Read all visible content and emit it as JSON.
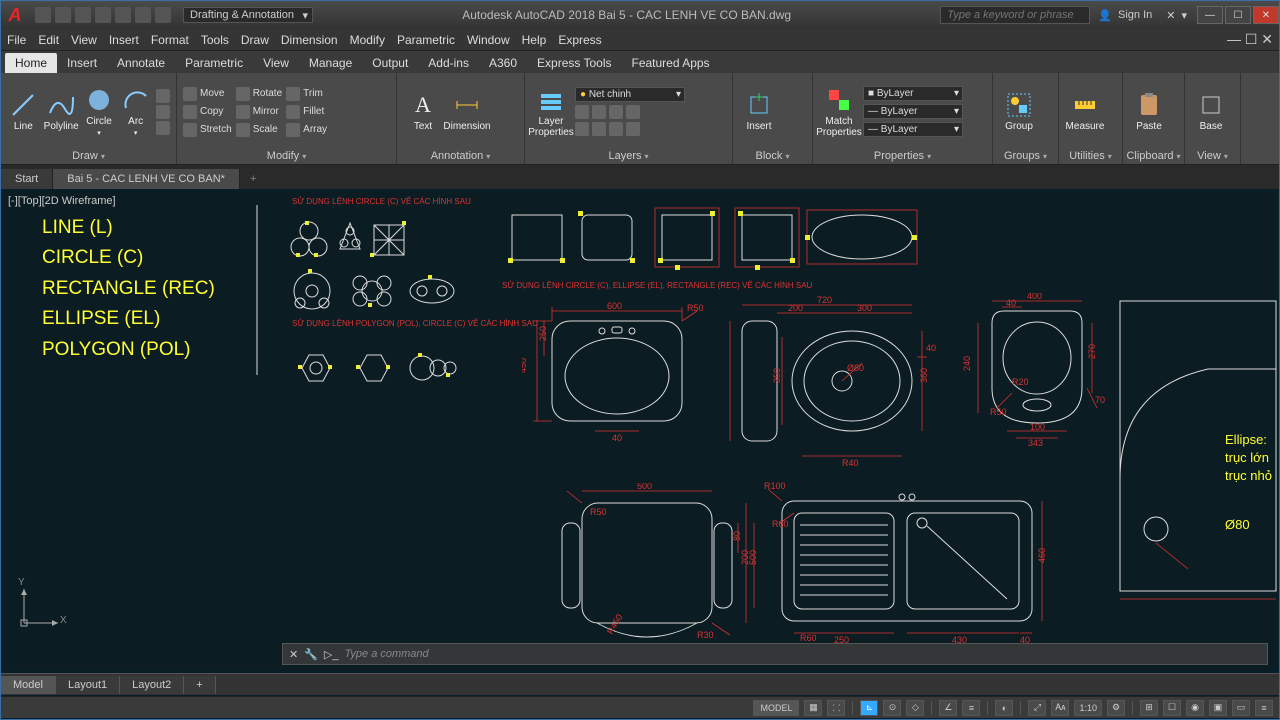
{
  "window": {
    "app_title": "Autodesk AutoCAD 2018   Bai 5 - CAC LENH VE CO BAN.dwg",
    "workspace": "Drafting & Annotation",
    "search_placeholder": "Type a keyword or phrase",
    "signin": "Sign In"
  },
  "menubar": [
    "File",
    "Edit",
    "View",
    "Insert",
    "Format",
    "Tools",
    "Draw",
    "Dimension",
    "Modify",
    "Parametric",
    "Window",
    "Help",
    "Express"
  ],
  "ribbon_tabs": [
    "Home",
    "Insert",
    "Annotate",
    "Parametric",
    "View",
    "Manage",
    "Output",
    "Add-ins",
    "A360",
    "Express Tools",
    "Featured Apps"
  ],
  "ribbon_active": "Home",
  "ribbon": {
    "draw": {
      "title": "Draw",
      "tools": [
        "Line",
        "Polyline",
        "Circle",
        "Arc"
      ]
    },
    "modify": {
      "title": "Modify",
      "rows": [
        [
          "Move",
          "Rotate",
          "Trim"
        ],
        [
          "Copy",
          "Mirror",
          "Fillet"
        ],
        [
          "Stretch",
          "Scale",
          "Array"
        ]
      ]
    },
    "annotation": {
      "title": "Annotation",
      "tools": [
        "Text",
        "Dimension"
      ]
    },
    "layers": {
      "title": "Layers",
      "tool": "Layer Properties",
      "current": "Net chinh"
    },
    "block": {
      "title": "Block",
      "tool": "Insert"
    },
    "properties": {
      "title": "Properties",
      "tool": "Match Properties",
      "v1": "ByLayer",
      "v2": "ByLayer",
      "v3": "ByLayer"
    },
    "groups": {
      "title": "Groups",
      "tool": "Group"
    },
    "utilities": {
      "title": "Utilities",
      "tool": "Measure"
    },
    "clipboard": {
      "title": "Clipboard",
      "tool": "Paste"
    },
    "view": {
      "title": "View",
      "tool": "Base"
    }
  },
  "filetabs": {
    "items": [
      "Start",
      "Bai 5 - CAC LENH VE CO BAN*"
    ],
    "active": 1
  },
  "canvas": {
    "view_label": "[-][Top][2D Wireframe]",
    "commands": [
      "LINE (L)",
      "CIRCLE (C)",
      "RECTANGLE (REC)",
      "ELLIPSE (EL)",
      "POLYGON (POL)"
    ],
    "notes": {
      "n1_pre": "SỬ DỤNG LỆNH ",
      "n1_mid": "CIRCLE (C)",
      "n1_post": " VẼ CÁC HÌNH SAU",
      "n2_pre": "SỬ DỤNG LỆNH ",
      "n2_mid": "CIRCLE (C), ELLIPSE (EL), RECTANGLE (REC)",
      "n2_post": " VẼ CÁC HÌNH SAU",
      "n3_pre": "SỬ DỤNG LỆNH ",
      "n3_mid": "POLYGON (POL), CIRCLE (C)",
      "n3_post": " VẼ CÁC HÌNH SAU"
    },
    "dims": {
      "d600": "600",
      "d450": "450",
      "d250": "250",
      "d40": "40",
      "dR50": "R50",
      "d720": "720",
      "d200": "200",
      "d300": "300",
      "d520": "520",
      "d350": "350",
      "d360": "360",
      "d80": "Ø80",
      "dR40": "R40",
      "d40b": "40",
      "d400": "400",
      "d40c": "40",
      "d270": "270",
      "d240": "240",
      "dR20": "R20",
      "d70": "70",
      "d100": "100",
      "d343": "343",
      "dR50b": "R50",
      "d500": "500",
      "d80b": "80",
      "d200b": "200",
      "d500b": "500",
      "dR30": "R30",
      "dR450": "R450",
      "dR50c": "R50",
      "dR60": "R60",
      "d250b": "250",
      "d430": "430",
      "d40d": "40",
      "d460": "460",
      "dR100": "R100",
      "dR60b": "R60"
    },
    "detail": {
      "l1": "Ellipse:",
      "l2": "trục lớn",
      "l3": "trục nhỏ",
      "l4": "Ø80"
    },
    "ucs": {
      "x": "X",
      "y": "Y"
    }
  },
  "cmdline": {
    "placeholder": "Type a command"
  },
  "layouts": [
    "Model",
    "Layout1",
    "Layout2"
  ],
  "status": {
    "model": "MODEL",
    "scale": "1:10"
  }
}
